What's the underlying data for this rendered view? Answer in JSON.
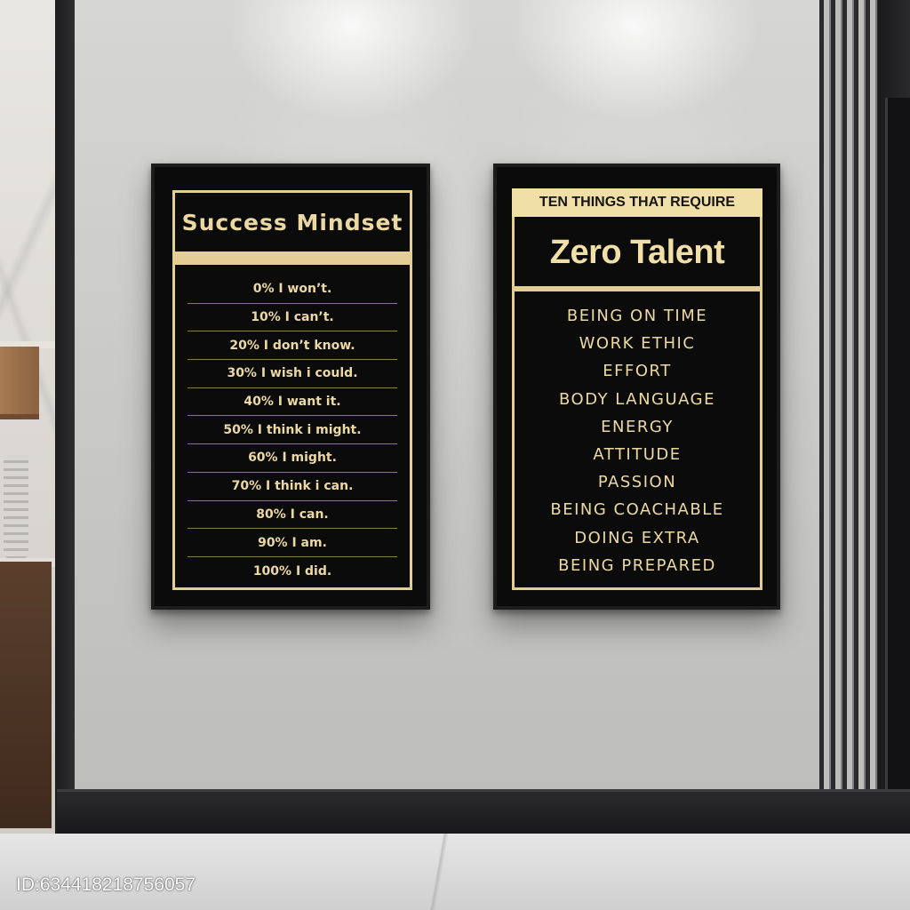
{
  "left_poster": {
    "title": "Success Mindset",
    "items": [
      "0% I won’t.",
      "10% I can’t.",
      "20% I don’t know.",
      "30% I wish i could.",
      "40% I want it.",
      "50% I think i might.",
      "60% I might.",
      "70% I think i can.",
      "80% I can.",
      "90% I am.",
      "100% I did."
    ]
  },
  "right_poster": {
    "header": "TEN THINGS THAT REQUIRE",
    "title": "Zero Talent",
    "items": [
      "BEING ON TIME",
      "WORK ETHIC",
      "EFFORT",
      "BODY LANGUAGE",
      "ENERGY",
      "ATTITUDE",
      "PASSION",
      "BEING COACHABLE",
      "DOING EXTRA",
      "BEING PREPARED"
    ]
  },
  "watermark": "ID:634418218756057",
  "colors": {
    "poster_background": "#0b0b0b",
    "gold_text": "#ecd9a2",
    "gold_border": "#e3cf95",
    "wall": "#cfcfcd"
  }
}
